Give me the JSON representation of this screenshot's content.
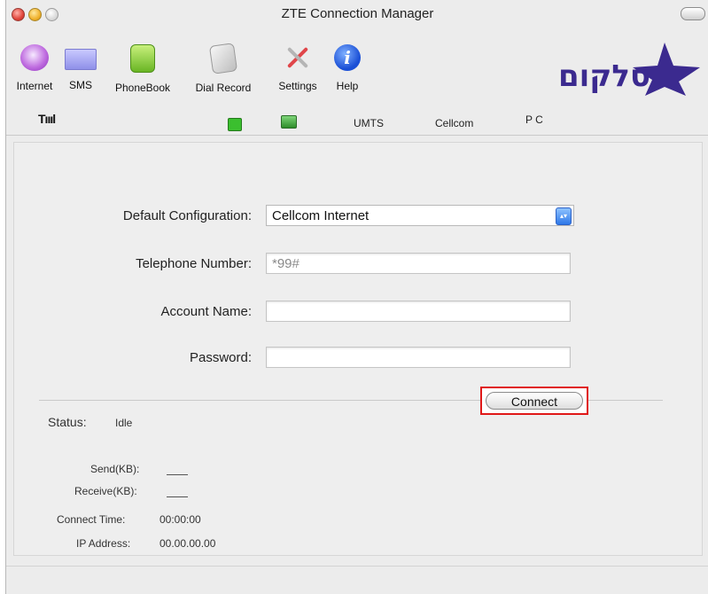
{
  "window": {
    "title": "ZTE Connection Manager"
  },
  "toolbar": {
    "items": [
      {
        "label": "Internet",
        "icon": "internet-globe-icon"
      },
      {
        "label": "SMS",
        "icon": "sms-envelope-icon"
      },
      {
        "label": "PhoneBook",
        "icon": "phonebook-icon"
      },
      {
        "label": "Dial Record",
        "icon": "dial-record-icon"
      },
      {
        "label": "Settings",
        "icon": "settings-tools-icon"
      },
      {
        "label": "Help",
        "icon": "help-info-icon"
      }
    ],
    "help_glyph": "i"
  },
  "brand": {
    "logo_text": "סלקום",
    "logo_color": "#3b2a8f"
  },
  "status_bar": {
    "signal": "Tıııl",
    "network_type": "UMTS",
    "operator": "Cellcom",
    "mode": "P C"
  },
  "form": {
    "default_configuration": {
      "label": "Default Configuration:",
      "value": "Cellcom Internet",
      "arrow": "▴▾"
    },
    "telephone_number": {
      "label": "Telephone Number:",
      "value": "*99#"
    },
    "account_name": {
      "label": "Account Name:",
      "value": ""
    },
    "password": {
      "label": "Password:",
      "value": ""
    }
  },
  "status": {
    "label": "Status:",
    "value": "Idle",
    "send_label": "Send(KB):",
    "receive_label": "Receive(KB):",
    "connect_time_label": "Connect Time:",
    "connect_time": "00:00:00",
    "ip_label": "IP Address:",
    "ip": "00.00.00.00"
  },
  "actions": {
    "connect_label": "Connect",
    "highlight_color": "#e01818"
  }
}
